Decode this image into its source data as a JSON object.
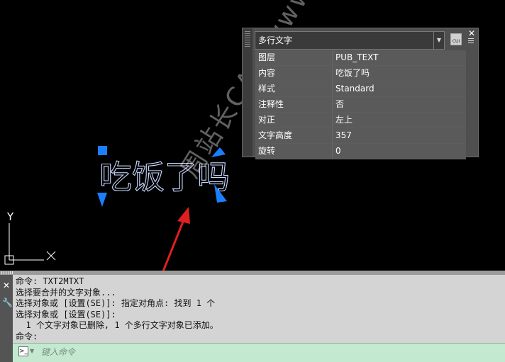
{
  "colors": {
    "canvas_bg": "#000000",
    "mtext_outline": "#c9d8ff",
    "grip": "#1a7fff",
    "arrow": "#e02020",
    "command_bg": "#d4d4d4",
    "command_input_bg": "#c3ead0"
  },
  "properties_panel": {
    "selected_type": "多行文字",
    "icons": {
      "cui": "cui-icon",
      "close": "close-icon",
      "menu": "menu-icon"
    },
    "rows": [
      {
        "key": "图层",
        "value": "PUB_TEXT"
      },
      {
        "key": "内容",
        "value": "吃饭了吗"
      },
      {
        "key": "样式",
        "value": "Standard"
      },
      {
        "key": "注释性",
        "value": "否"
      },
      {
        "key": "对正",
        "value": "左上"
      },
      {
        "key": "文字高度",
        "value": "357"
      },
      {
        "key": "旋转",
        "value": "0"
      }
    ]
  },
  "canvas": {
    "mtext_content": "吃饭了吗",
    "ucs_y_label": "Y",
    "ucs_x_label": "X",
    "watermark": "周站长CAD www.zzzcad.com"
  },
  "command_line": {
    "history": [
      "命令: TXT2MTXT",
      "选择要合并的文字对象...",
      "选择对象或 [设置(SE)]: 指定对角点: 找到 1 个",
      "选择对象或 [设置(SE)]:",
      "  1 个文字对象已删除, 1 个多行文字对象已添加。",
      "命令:"
    ],
    "input_placeholder": "键入命令",
    "icons": {
      "close": "close-icon",
      "settings": "wrench-icon",
      "prompt": "command-prompt-icon"
    }
  }
}
